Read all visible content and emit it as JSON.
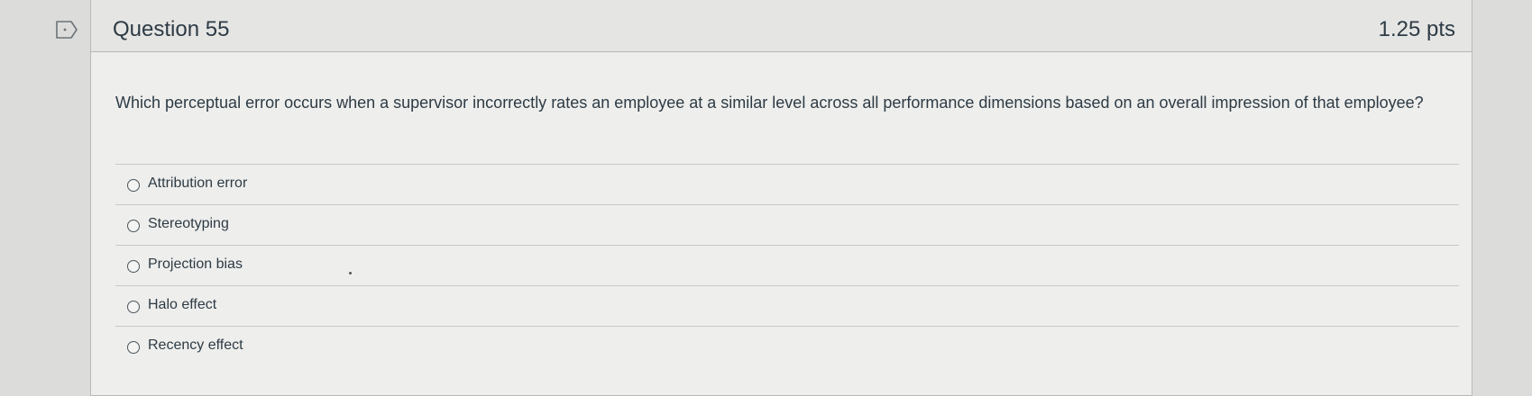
{
  "question": {
    "title": "Question 55",
    "points": "1.25 pts",
    "text": "Which perceptual error occurs when a supervisor incorrectly rates an employee at a similar level across all performance dimensions based on an overall impression of that employee?",
    "answers": [
      {
        "label": "Attribution error",
        "selected": false
      },
      {
        "label": "Stereotyping",
        "selected": false
      },
      {
        "label": "Projection bias",
        "selected": false
      },
      {
        "label": "Halo effect",
        "selected": false
      },
      {
        "label": "Recency effect",
        "selected": false
      }
    ]
  },
  "icons": {
    "flag": "flag-question-icon"
  },
  "colors": {
    "text": "#2d3b45",
    "card_background": "#eeeeec",
    "header_background": "#e5e5e3",
    "page_background": "#dcdcda",
    "border": "#b9bab8"
  }
}
